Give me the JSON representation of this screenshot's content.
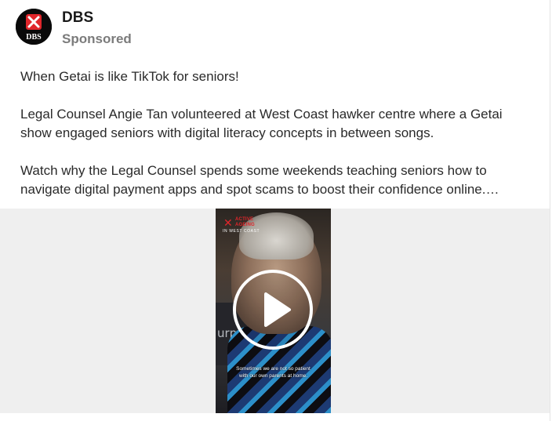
{
  "post": {
    "brand_name": "DBS",
    "brand_logo_text": "DBS",
    "label": "Sponsored",
    "text": {
      "p1": "When Getai is like TikTok for seniors!",
      "p2_line1": "Legal Counsel Angie Tan volunteered at West Coast hawker centre where a Getai",
      "p2_line2": "show engaged seniors with digital literacy concepts in between songs.",
      "p3_line1": "Watch why the Legal Counsel spends some weekends teaching seniors how to",
      "p3_line2": "navigate digital payment apps and spot scams to boost their confidence online.…"
    }
  },
  "video": {
    "logo_mark": "✕",
    "logo_line1": "ACTIVE",
    "logo_line2": "AGEING",
    "logo_line3": "IN WEST COAST",
    "stall_text": "urpo",
    "caption_line1": "Sometimes we are not so patient",
    "caption_line2": "with our own parents at home.",
    "play_icon": "play-icon"
  },
  "colors": {
    "brand_red": "#e0262b",
    "sponsored_gray": "#7b7b7b",
    "media_bg": "#efefef"
  }
}
